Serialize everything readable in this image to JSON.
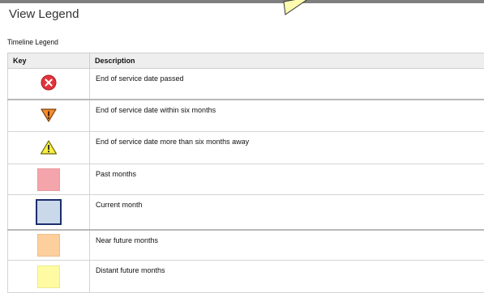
{
  "dialog": {
    "title": "View Legend"
  },
  "section": {
    "label": "Timeline Legend"
  },
  "table": {
    "headers": {
      "key": "Key",
      "description": "Description"
    },
    "rows": [
      {
        "icon": "error-circle-icon",
        "description": "End of service date passed"
      },
      {
        "icon": "warning-orange-icon",
        "description": "End of service date within six months"
      },
      {
        "icon": "warning-yellow-icon",
        "description": "End of service date more than six months away"
      },
      {
        "icon": "past-months-swatch",
        "description": "Past months",
        "color": "#f4a5ab"
      },
      {
        "icon": "current-month-swatch",
        "description": "Current month",
        "color": "#c9d9ea"
      },
      {
        "icon": "near-future-months-swatch",
        "description": "Near future months",
        "color": "#fccf9d"
      },
      {
        "icon": "distant-future-months-swatch",
        "description": "Distant future months",
        "color": "#fefba3"
      }
    ]
  }
}
